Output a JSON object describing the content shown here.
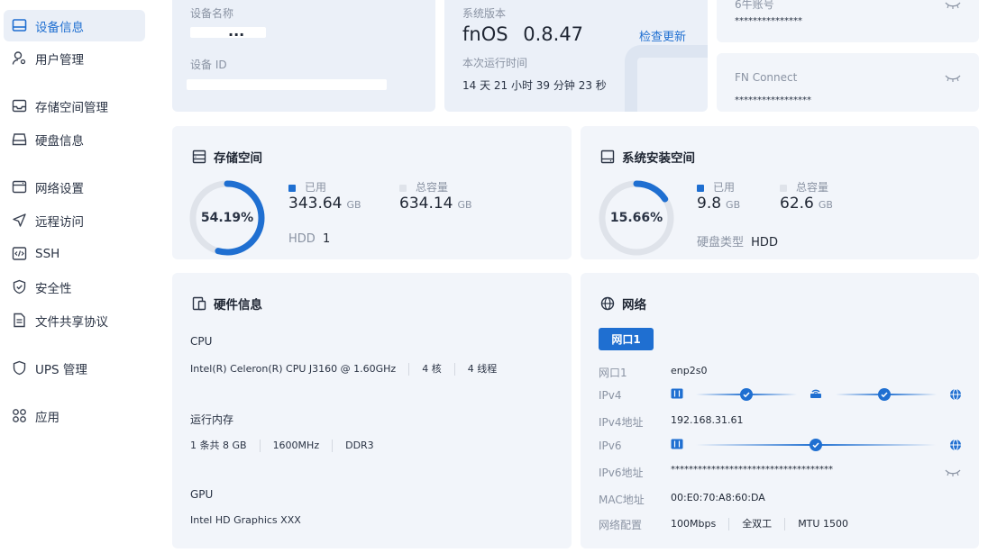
{
  "sidebar": {
    "items": [
      {
        "label": "设备信息",
        "icon": "device-info-icon",
        "active": true
      },
      {
        "label": "用户管理",
        "icon": "user-management-icon"
      },
      {
        "label": "存储空间管理",
        "icon": "storage-management-icon"
      },
      {
        "label": "硬盘信息",
        "icon": "disk-info-icon"
      },
      {
        "label": "网络设置",
        "icon": "network-settings-icon"
      },
      {
        "label": "远程访问",
        "icon": "remote-access-icon"
      },
      {
        "label": "SSH",
        "icon": "ssh-icon"
      },
      {
        "label": "安全性",
        "icon": "security-icon"
      },
      {
        "label": "文件共享协议",
        "icon": "file-sharing-icon"
      },
      {
        "label": "UPS 管理",
        "icon": "ups-icon"
      },
      {
        "label": "应用",
        "icon": "apps-icon"
      }
    ]
  },
  "device": {
    "name_label": "设备名称",
    "name_value": "...",
    "id_label": "设备 ID"
  },
  "system": {
    "version_label": "系统版本",
    "os_name": "fnOS",
    "version": "0.8.47",
    "check_update": "检查更新",
    "uptime_label": "本次运行时间",
    "uptime": "14 天 21 小时 39 分钟 23 秒"
  },
  "accounts": {
    "account_label": "6牛账号",
    "account_value": "***************",
    "fn_connect_label": "FN Connect",
    "fn_connect_value": "*****************"
  },
  "storage": {
    "title": "存储空间",
    "percent": "54.19%",
    "percent_value": 54.19,
    "used_label": "已用",
    "used_value": "343.64",
    "used_unit": "GB",
    "total_label": "总容量",
    "total_value": "634.14",
    "total_unit": "GB",
    "hdd_label": "HDD",
    "hdd_count": "1"
  },
  "system_space": {
    "title": "系统安装空间",
    "percent": "15.66%",
    "percent_value": 15.66,
    "used_label": "已用",
    "used_value": "9.8",
    "used_unit": "GB",
    "total_label": "总容量",
    "total_value": "62.6",
    "total_unit": "GB",
    "disk_type_label": "硬盘类型",
    "disk_type": "HDD"
  },
  "hardware": {
    "title": "硬件信息",
    "cpu_label": "CPU",
    "cpu_model": "Intel(R) Celeron(R) CPU J3160 @ 1.60GHz",
    "cpu_cores": "4 核",
    "cpu_threads": "4 线程",
    "ram_label": "运行内存",
    "ram_sticks": "1 条共 8 GB",
    "ram_freq": "1600MHz",
    "ram_type": "DDR3",
    "gpu_label": "GPU",
    "gpu_model": "Intel HD Graphics XXX"
  },
  "network": {
    "title": "网络",
    "port_button": "网口1",
    "port_label": "网口1",
    "port_value": "enp2s0",
    "ipv4_label": "IPv4",
    "ipv4_addr_label": "IPv4地址",
    "ipv4_addr": "192.168.31.61",
    "ipv6_label": "IPv6",
    "ipv6_addr_label": "IPv6地址",
    "ipv6_addr": "************************************",
    "mac_label": "MAC地址",
    "mac": "00:E0:70:A8:60:DA",
    "config_label": "网络配置",
    "speed": "100Mbps",
    "duplex": "全双工",
    "mtu": "MTU 1500"
  },
  "colors": {
    "accent": "#1f6fd1",
    "card_bg": "#f2f5fa",
    "ring_track": "#dfe3ea",
    "muted": "#8a93a3"
  }
}
